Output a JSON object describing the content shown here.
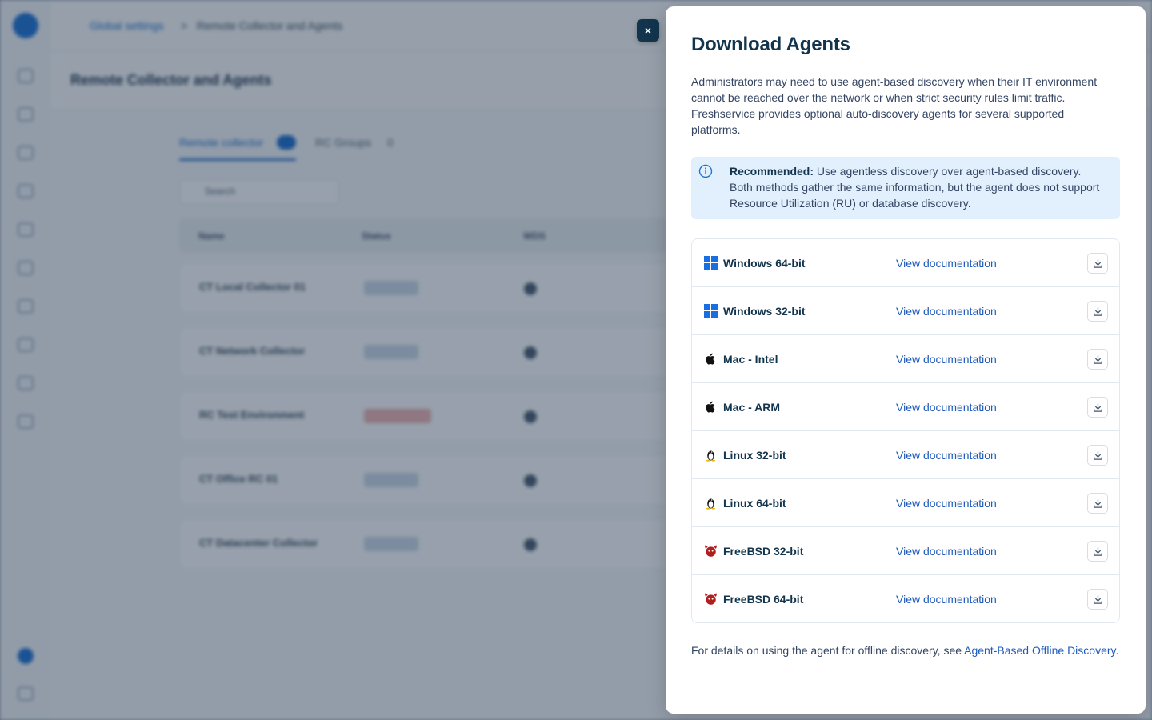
{
  "background": {
    "breadcrumb": {
      "parent": "Global settings",
      "current": "Remote Collector and Agents"
    },
    "page_title": "Remote Collector and Agents",
    "tabs": [
      {
        "label": "Remote collector",
        "count": "5"
      },
      {
        "label": "RC Groups",
        "count": "0"
      }
    ],
    "search_placeholder": "Search",
    "columns": [
      "Name",
      "Status",
      "WDS"
    ],
    "rows": [
      {
        "name": "CT Local Collector 01",
        "status": "Connected"
      },
      {
        "name": "CT Network Collector",
        "status": "Connected"
      },
      {
        "name": "RC Test Environment",
        "status": "Disconnected"
      },
      {
        "name": "CT Office RC 01",
        "status": "Connected"
      },
      {
        "name": "CT Datacenter Collector",
        "status": "Connected"
      }
    ]
  },
  "drawer": {
    "close_label": "×",
    "title": "Download Agents",
    "intro": "Administrators may need to use agent-based discovery when their IT environment cannot be reached over the network or when strict security rules limit traffic. Freshservice provides optional auto-discovery agents for several supported platforms.",
    "callout": {
      "title": "Recommended:",
      "text": " Use agentless discovery over agent-based discovery. Both methods gather the same information, but the agent does not support Resource Utilization (RU) or database discovery."
    },
    "doc_label": "View documentation",
    "agents": [
      {
        "name": "Windows 64-bit",
        "icon": "windows-icon"
      },
      {
        "name": "Windows 32-bit",
        "icon": "windows-icon"
      },
      {
        "name": "Mac - Intel",
        "icon": "apple-icon"
      },
      {
        "name": "Mac - ARM",
        "icon": "apple-icon"
      },
      {
        "name": "Linux 32-bit",
        "icon": "linux-icon"
      },
      {
        "name": "Linux 64-bit",
        "icon": "linux-icon"
      },
      {
        "name": "FreeBSD 32-bit",
        "icon": "freebsd-icon"
      },
      {
        "name": "FreeBSD 64-bit",
        "icon": "freebsd-icon"
      }
    ],
    "footer": {
      "text": "For details on using the agent for offline discovery, see ",
      "link": "Agent-Based Offline Discovery",
      "end": "."
    }
  },
  "colors": {
    "link": "#1f5bbd",
    "callout_bg": "#e2f0fd",
    "close_bg": "#12344d",
    "windows_blue": "#1a6fe0",
    "freebsd_red": "#b01e1e"
  }
}
